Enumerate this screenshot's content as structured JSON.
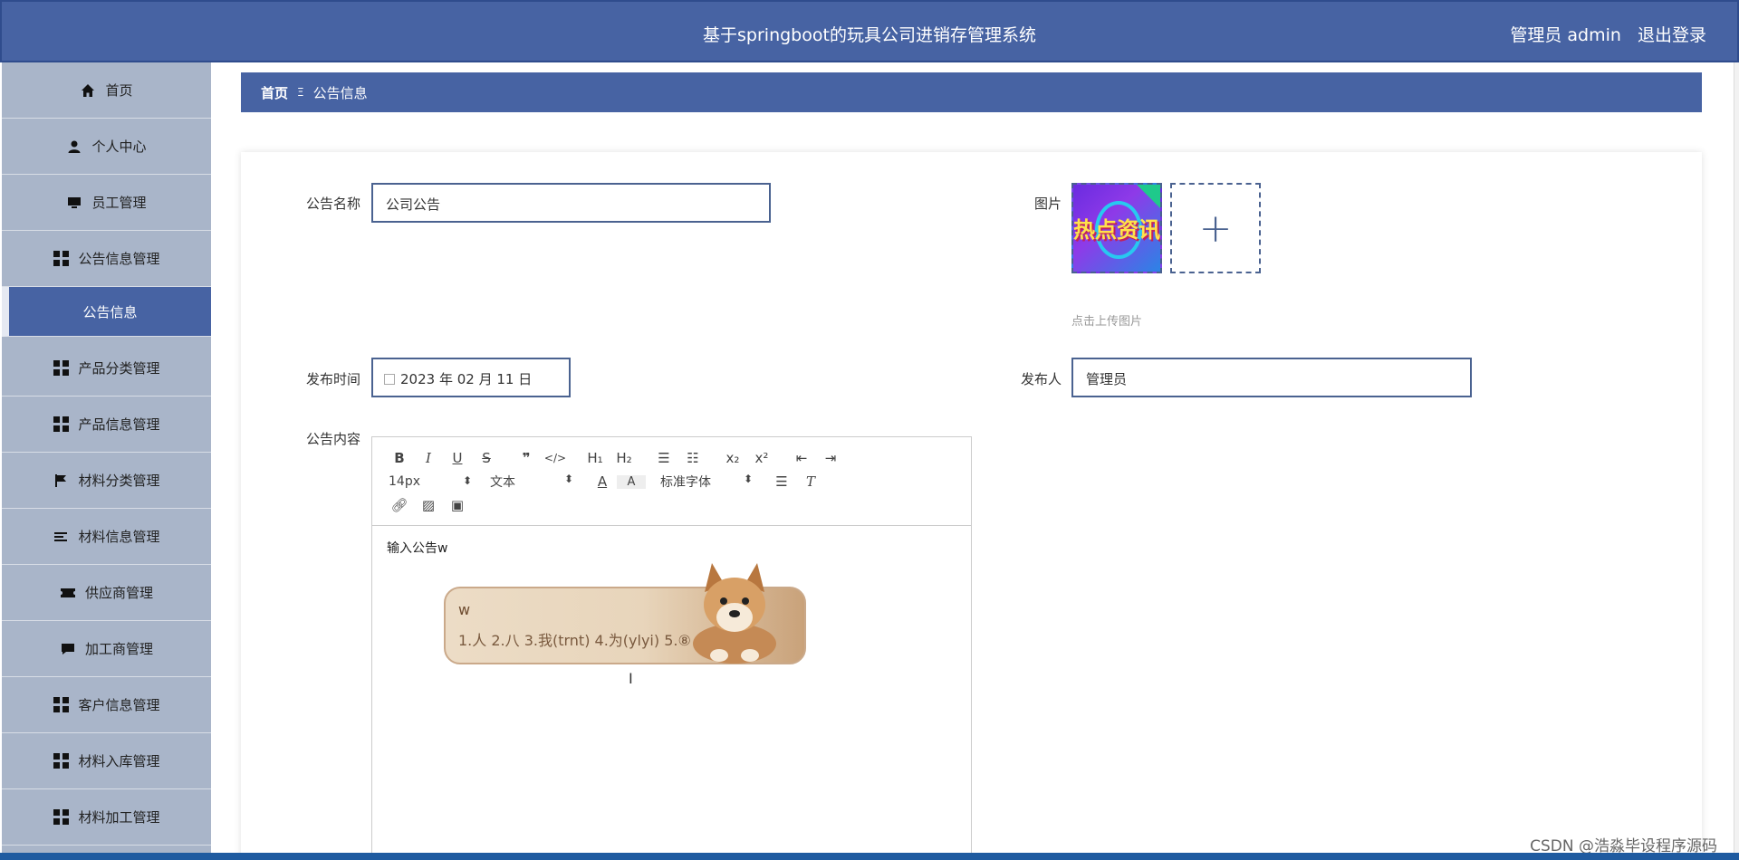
{
  "app": {
    "title": "基于springboot的玩具公司进销存管理系统",
    "user_label": "管理员 admin",
    "logout_label": "退出登录"
  },
  "sidebar": {
    "items": [
      {
        "label": "首页",
        "icon": "home-icon"
      },
      {
        "label": "个人中心",
        "icon": "user-icon"
      },
      {
        "label": "员工管理",
        "icon": "monitor-icon"
      },
      {
        "label": "公告信息管理",
        "icon": "grid-icon"
      },
      {
        "label": "公告信息",
        "icon": "",
        "active": true
      },
      {
        "label": "产品分类管理",
        "icon": "grid-icon"
      },
      {
        "label": "产品信息管理",
        "icon": "grid-icon"
      },
      {
        "label": "材料分类管理",
        "icon": "flag-icon"
      },
      {
        "label": "材料信息管理",
        "icon": "list-icon"
      },
      {
        "label": "供应商管理",
        "icon": "ticket-icon"
      },
      {
        "label": "加工商管理",
        "icon": "chat-icon"
      },
      {
        "label": "客户信息管理",
        "icon": "grid-icon"
      },
      {
        "label": "材料入库管理",
        "icon": "grid-icon"
      },
      {
        "label": "材料加工管理",
        "icon": "grid-icon"
      }
    ]
  },
  "breadcrumb": {
    "home": "首页",
    "separator": "Ξ",
    "current": "公告信息"
  },
  "form": {
    "name_label": "公告名称",
    "name_value": "公司公告",
    "image_label": "图片",
    "image_text": "热点资讯",
    "upload_hint": "点击上传图片",
    "date_label": "发布时间",
    "date_value": "2023 年 02 月 11 日",
    "publisher_label": "发布人",
    "publisher_value": "管理员",
    "content_label": "公告内容"
  },
  "editor": {
    "font_size": "14px",
    "paragraph": "文本",
    "font_family": "标准字体",
    "content": "输入公告w"
  },
  "ime": {
    "input": "w",
    "candidates": "1.人  2.八  3.我(trnt)  4.为(ylyi)  5.⑧"
  },
  "watermark": "CSDN @浩淼毕设程序源码",
  "colors": {
    "primary": "#4763a3",
    "sidebar": "#a9b5c9",
    "input_border": "#4a6290"
  }
}
